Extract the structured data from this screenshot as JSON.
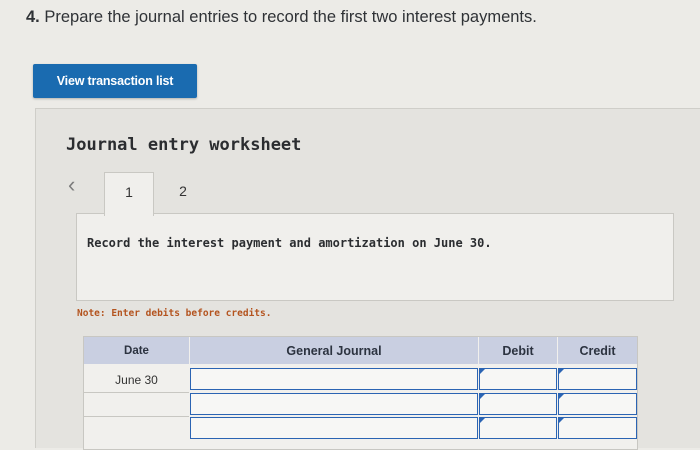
{
  "question": {
    "number": "4.",
    "text": "Prepare the journal entries to record the first two interest payments."
  },
  "view_transaction_button": "View transaction list",
  "worksheet": {
    "title": "Journal entry worksheet",
    "prev_icon": "chevron-left-icon",
    "tabs": [
      {
        "label": "1",
        "active": true
      },
      {
        "label": "2",
        "active": false
      }
    ],
    "instruction": "Record the interest payment and amortization on June 30.",
    "note": "Note: Enter debits before credits."
  },
  "journal_table": {
    "headers": {
      "date": "Date",
      "general_journal": "General Journal",
      "debit": "Debit",
      "credit": "Credit"
    },
    "rows": [
      {
        "date": "June 30",
        "account": "",
        "debit": "",
        "credit": ""
      },
      {
        "date": "",
        "account": "",
        "debit": "",
        "credit": ""
      },
      {
        "date": "",
        "account": "",
        "debit": "",
        "credit": ""
      }
    ]
  },
  "colors": {
    "button_bg": "#1a6bb0",
    "header_bg": "#c9cfe1",
    "input_border": "#2b64b3",
    "note_text": "#b4541f"
  }
}
